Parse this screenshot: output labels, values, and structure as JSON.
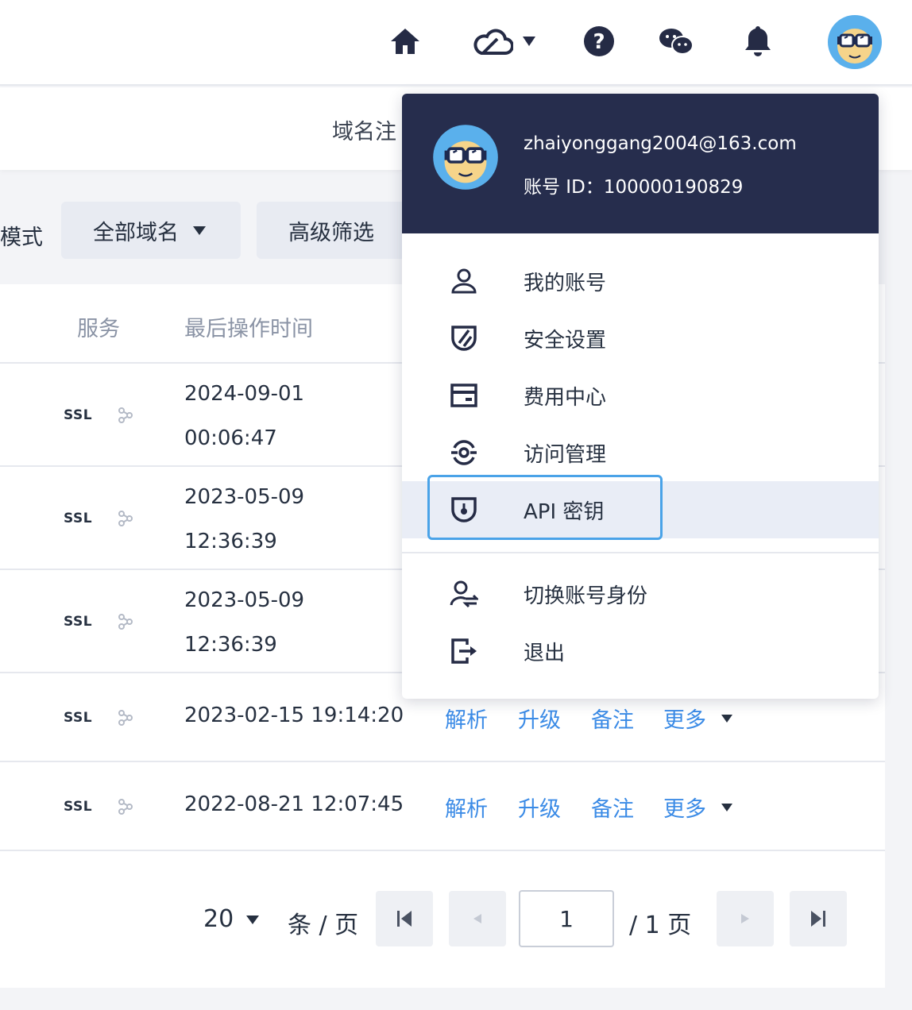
{
  "topbar": {
    "icons": [
      "home-icon",
      "cloud-icon",
      "help-icon",
      "wechat-icon",
      "bell-icon"
    ]
  },
  "subnav": {
    "tab_label": "域名注"
  },
  "filters": {
    "mode_label": "模式",
    "all_domains": "全部域名",
    "advanced": "高级筛选"
  },
  "table": {
    "headers": {
      "service": "服务",
      "last_op_time": "最后操作时间"
    },
    "rows": [
      {
        "ssl": "SSL",
        "date": "2024-09-01",
        "time": "00:06:47"
      },
      {
        "ssl": "SSL",
        "date": "2023-05-09",
        "time": "12:36:39"
      },
      {
        "ssl": "SSL",
        "date": "2023-05-09",
        "time": "12:36:39"
      },
      {
        "ssl": "SSL",
        "datetime": "2023-02-15 19:14:20",
        "actions": [
          "解析",
          "升级",
          "备注",
          "更多"
        ]
      },
      {
        "ssl": "SSL",
        "datetime": "2022-08-21 12:07:45",
        "actions": [
          "解析",
          "升级",
          "备注",
          "更多"
        ]
      }
    ]
  },
  "pagination": {
    "page_size": "20",
    "per_page": "条 / 页",
    "current_page": "1",
    "total": "/ 1 页"
  },
  "dropdown": {
    "email": "zhaiyonggang2004@163.com",
    "account_id": "账号 ID：100000190829",
    "items": [
      {
        "label": "我的账号",
        "icon": "user-icon"
      },
      {
        "label": "安全设置",
        "icon": "shield-icon"
      },
      {
        "label": "费用中心",
        "icon": "wallet-icon"
      },
      {
        "label": "访问管理",
        "icon": "access-icon"
      },
      {
        "label": "API 密钥",
        "icon": "key-shield-icon",
        "highlighted": true
      },
      {
        "label": "切换账号身份",
        "icon": "switch-user-icon"
      },
      {
        "label": "退出",
        "icon": "logout-icon"
      }
    ]
  },
  "colors": {
    "link": "#3b8be6",
    "header_bg": "#262d4d",
    "highlight": "#4aa3e8"
  }
}
